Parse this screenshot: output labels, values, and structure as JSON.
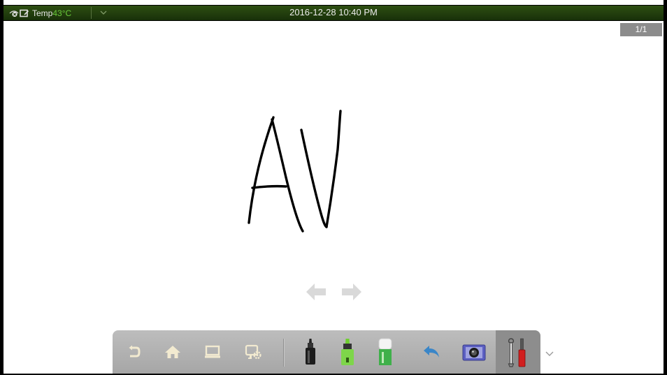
{
  "status_bar": {
    "temp_label": "Temp",
    "temp_value": "43°C",
    "datetime": "2016-12-28 10:40 PM"
  },
  "page_indicator": "1/1",
  "canvas": {
    "ink_color": "#000000"
  },
  "toolbar": {
    "items": [
      {
        "name": "exit",
        "icon": "exit-icon"
      },
      {
        "name": "home",
        "icon": "home-icon"
      },
      {
        "name": "screen",
        "icon": "screen-icon"
      },
      {
        "name": "screen-settings",
        "icon": "screen-settings-icon"
      },
      {
        "name": "pen",
        "icon": "pen-icon"
      },
      {
        "name": "highlighter",
        "icon": "highlighter-icon"
      },
      {
        "name": "eraser",
        "icon": "eraser-icon"
      },
      {
        "name": "undo",
        "icon": "undo-icon"
      },
      {
        "name": "screenshot",
        "icon": "camera-icon"
      },
      {
        "name": "tools",
        "icon": "tools-icon"
      }
    ]
  },
  "colors": {
    "status_bar": "#1f3a0e",
    "temp_value": "#69c93a",
    "toolbar": "#b3b3b3",
    "page_indicator": "#8c8c8c",
    "nav_arrows": "#d6d6d6"
  }
}
